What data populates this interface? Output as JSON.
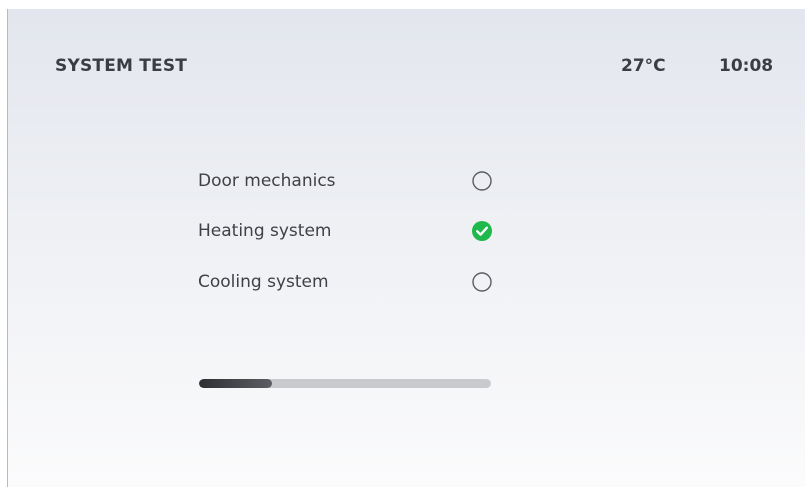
{
  "header": {
    "title": "SYSTEM TEST",
    "temperature": "27°C",
    "time": "10:08"
  },
  "tests": [
    {
      "label": "Door mechanics",
      "status": "pending",
      "icon": "empty-circle-icon"
    },
    {
      "label": "Heating system",
      "status": "passed",
      "icon": "check-circle-icon"
    },
    {
      "label": "Cooling system",
      "status": "pending",
      "icon": "empty-circle-icon"
    }
  ],
  "progress": {
    "fraction": 0.25
  },
  "colors": {
    "success": "#1fb84a",
    "pending_outline": "#5a5c62",
    "progress_track": "#c9cace",
    "progress_fill": "#3a3c40"
  }
}
